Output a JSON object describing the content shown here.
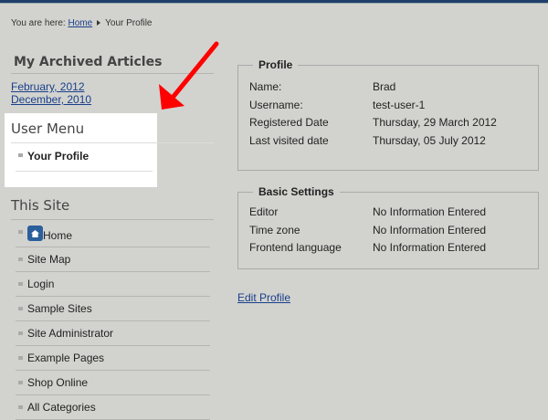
{
  "breadcrumb": {
    "prefix": "You are here:",
    "home": "Home",
    "current": "Your Profile"
  },
  "archive": {
    "title": "My Archived Articles",
    "links": [
      "February, 2012",
      "December, 2010"
    ]
  },
  "user_menu": {
    "title": "User Menu",
    "items": [
      "Your Profile"
    ]
  },
  "site": {
    "title": "This Site",
    "items": [
      "Home",
      "Site Map",
      "Login",
      "Sample Sites",
      "Site Administrator",
      "Example Pages",
      "Shop Online",
      "All Categories"
    ]
  },
  "profile": {
    "legend": "Profile",
    "rows": [
      {
        "k": "Name:",
        "v": "Brad"
      },
      {
        "k": "Username:",
        "v": "test-user-1"
      },
      {
        "k": "Registered Date",
        "v": "Thursday, 29 March 2012"
      },
      {
        "k": "Last visited date",
        "v": "Thursday, 05 July 2012"
      }
    ]
  },
  "basic": {
    "legend": "Basic Settings",
    "rows": [
      {
        "k": "Editor",
        "v": "No Information Entered"
      },
      {
        "k": "Time zone",
        "v": "No Information Entered"
      },
      {
        "k": "Frontend language",
        "v": "No Information Entered"
      }
    ]
  },
  "edit_profile": "Edit Profile",
  "colors": {
    "arrow": "#ff0000",
    "link": "#1a3f8a"
  }
}
